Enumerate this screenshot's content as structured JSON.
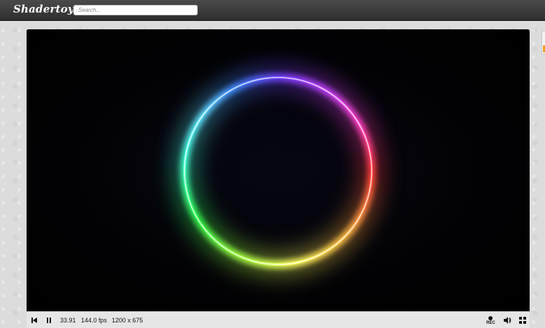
{
  "header": {
    "logo_text": "Shadertoy",
    "search": {
      "placeholder": "Search...",
      "value": ""
    }
  },
  "player": {
    "time": "33.91",
    "fps": "144.0 fps",
    "resolution": "1200 x 675",
    "rec_label": "REC",
    "icons": [
      "skip-back-icon",
      "pause-icon",
      "record-icon",
      "volume-icon",
      "fullscreen-icon"
    ]
  },
  "colors": {
    "topbar": "#3a3a3a",
    "page_background": "#dcdcdc",
    "controls_bar": "#e6e6e6",
    "canvas_background": "#000000"
  }
}
